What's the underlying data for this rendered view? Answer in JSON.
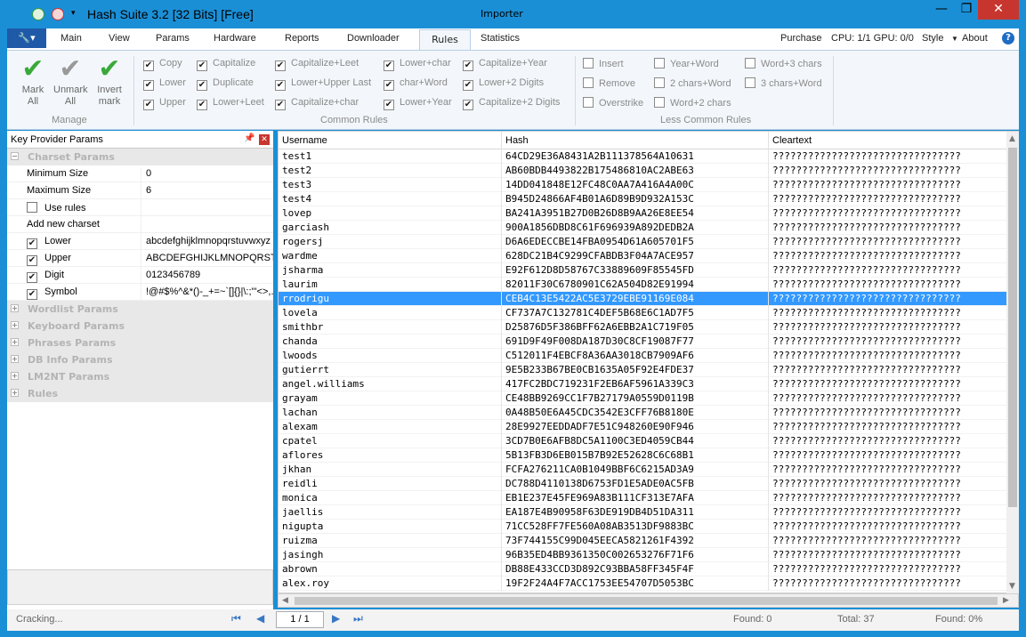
{
  "window": {
    "title": "Hash Suite 3.2 [32 Bits] [Free]",
    "document_title": "Importer",
    "buttons": {
      "minimize": "—",
      "maximize": "❐",
      "close": "✕"
    }
  },
  "menu": {
    "app_button": "🔧▾",
    "tabs": [
      "Main",
      "View",
      "Params",
      "Hardware",
      "Reports",
      "Downloader",
      "Rules",
      "Statistics"
    ],
    "active_tab": "Rules",
    "right": {
      "purchase": "Purchase",
      "cpu_gpu": "CPU: 1/1 GPU: 0/0",
      "style": "Style",
      "about": "About",
      "help": "?"
    }
  },
  "ribbon": {
    "manage": {
      "label": "Manage",
      "buttons": [
        {
          "label1": "Mark",
          "label2": "All"
        },
        {
          "label1": "Unmark",
          "label2": "All"
        },
        {
          "label1": "Invert",
          "label2": "mark"
        }
      ]
    },
    "common": {
      "label": "Common Rules",
      "rules": [
        [
          "Copy",
          "Lower",
          "Upper"
        ],
        [
          "Capitalize",
          "Duplicate",
          "Lower+Leet"
        ],
        [
          "Capitalize+Leet",
          "Lower+Upper Last",
          "Capitalize+char"
        ],
        [
          "Lower+char",
          "char+Word",
          "Lower+Year"
        ],
        [
          "Capitalize+Year",
          "Lower+2 Digits",
          "Capitalize+2 Digits"
        ]
      ]
    },
    "less": {
      "label": "Less Common Rules",
      "rules": [
        [
          "Insert",
          "Remove",
          "Overstrike"
        ],
        [
          "Year+Word",
          "2 chars+Word",
          "Word+2 chars"
        ],
        [
          "Word+3 chars",
          "3 chars+Word"
        ]
      ]
    }
  },
  "panel": {
    "title": "Key Provider Params",
    "pin": "📌",
    "close": "✕",
    "charset_category": "Charset Params",
    "rows": [
      {
        "label": "Minimum Size",
        "value": "0"
      },
      {
        "label": "Maximum Size",
        "value": "6"
      },
      {
        "label": "Use rules",
        "value": "",
        "checked": false
      },
      {
        "label": "Add new charset",
        "value": ""
      },
      {
        "label": "Lower",
        "value": "abcdefghijklmnopqrstuvwxyz",
        "checked": true
      },
      {
        "label": "Upper",
        "value": "ABCDEFGHIJKLMNOPQRSTUVWXYZ",
        "checked": true
      },
      {
        "label": "Digit",
        "value": "0123456789",
        "checked": true
      },
      {
        "label": "Symbol",
        "value": " !@#$%^&*()-_+=~`[]{}|\\:;\"'<>,.?/",
        "checked": true
      }
    ],
    "categories": [
      "Wordlist Params",
      "Keyboard Params",
      "Phrases Params",
      "DB Info Params",
      "LM2NT Params",
      "Rules"
    ]
  },
  "grid": {
    "columns": [
      "Username",
      "Hash",
      "Cleartext"
    ],
    "rows": [
      [
        "test1",
        "64CD29E36A8431A2B111378564A10631",
        "????????????????????????????????"
      ],
      [
        "test2",
        "AB60BDB4493822B175486810AC2ABE63",
        "????????????????????????????????"
      ],
      [
        "test3",
        "14DD041848E12FC48C0AA7A416A4A00C",
        "????????????????????????????????"
      ],
      [
        "test4",
        "B945D24866AF4B01A6D89B9D932A153C",
        "????????????????????????????????"
      ],
      [
        "lovep",
        "BA241A3951B27D0B26D8B9AA26E8EE54",
        "????????????????????????????????"
      ],
      [
        "garciash",
        "900A1856DBD8C61F696939A892DEDB2A",
        "????????????????????????????????"
      ],
      [
        "rogersj",
        "D6A6EDECCBE14FBA0954D61A605701F5",
        "????????????????????????????????"
      ],
      [
        "wardme",
        "628DC21B4C9299CFABDB3F04A7ACE957",
        "????????????????????????????????"
      ],
      [
        "jsharma",
        "E92F612D8D58767C33889609F85545FD",
        "????????????????????????????????"
      ],
      [
        "laurim",
        "82011F30C6780901C62A504D82E91994",
        "????????????????????????????????"
      ],
      [
        "rrodrigu",
        "CEB4C13E5422AC5E3729EBE91169E084",
        "????????????????????????????????"
      ],
      [
        "lovela",
        "CF737A7C132781C4DEF5B68E6C1AD7F5",
        "????????????????????????????????"
      ],
      [
        "smithbr",
        "D25876D5F386BFF62A6EBB2A1C719F05",
        "????????????????????????????????"
      ],
      [
        "chanda",
        "691D9F49F008DA187D30C8CF19087F77",
        "????????????????????????????????"
      ],
      [
        "lwoods",
        "C512011F4EBCF8A36AA3018CB7909AF6",
        "????????????????????????????????"
      ],
      [
        "gutierrt",
        "9E5B233B67BE0CB1635A05F92E4FDE37",
        "????????????????????????????????"
      ],
      [
        "angel.williams",
        "417FC2BDC719231F2EB6AF5961A339C3",
        "????????????????????????????????"
      ],
      [
        "grayam",
        "CE48BB9269CC1F7B27179A0559D0119B",
        "????????????????????????????????"
      ],
      [
        "lachan",
        "0A48B50E6A45CDC3542E3CFF76B8180E",
        "????????????????????????????????"
      ],
      [
        "alexam",
        "28E9927EEDDADF7E51C948260E90F946",
        "????????????????????????????????"
      ],
      [
        "cpatel",
        "3CD7B0E6AFB8DC5A1100C3ED4059CB44",
        "????????????????????????????????"
      ],
      [
        "aflores",
        "5B13FB3D6EB015B7B92E52628C6C68B1",
        "????????????????????????????????"
      ],
      [
        "jkhan",
        "FCFA276211CA0B1049BBF6C6215AD3A9",
        "????????????????????????????????"
      ],
      [
        "reidli",
        "DC788D4110138D6753FD1E5ADE0AC5FB",
        "????????????????????????????????"
      ],
      [
        "monica",
        "EB1E237E45FE969A83B111CF313E7AFA",
        "????????????????????????????????"
      ],
      [
        "jaellis",
        "EA187E4B90958F63DE919DB4D51DA311",
        "????????????????????????????????"
      ],
      [
        "nigupta",
        "71CC528FF7FE560A08AB3513DF9883BC",
        "????????????????????????????????"
      ],
      [
        "ruizma",
        "73F744155C99D045EECA5821261F4392",
        "????????????????????????????????"
      ],
      [
        "jasingh",
        "96B35ED4BB9361350C002653276F71F6",
        "????????????????????????????????"
      ],
      [
        "abrown",
        "DB88E433CCD3D892C93BBA58FF345F4F",
        "????????????????????????????????"
      ],
      [
        "alex.roy",
        "19F2F24A4F7ACC1753EE54707D5053BC",
        "????????????????????????????????"
      ]
    ],
    "selected_index": 10
  },
  "status": {
    "left": "Cracking...",
    "page": "1 / 1",
    "found": "Found: 0",
    "total": "Total: 37",
    "found_pct": "Found: 0%"
  },
  "colors": {
    "accent": "#1b8fd6",
    "selection": "#3399ff",
    "check": "#3aa93a",
    "close": "#c7362e"
  }
}
